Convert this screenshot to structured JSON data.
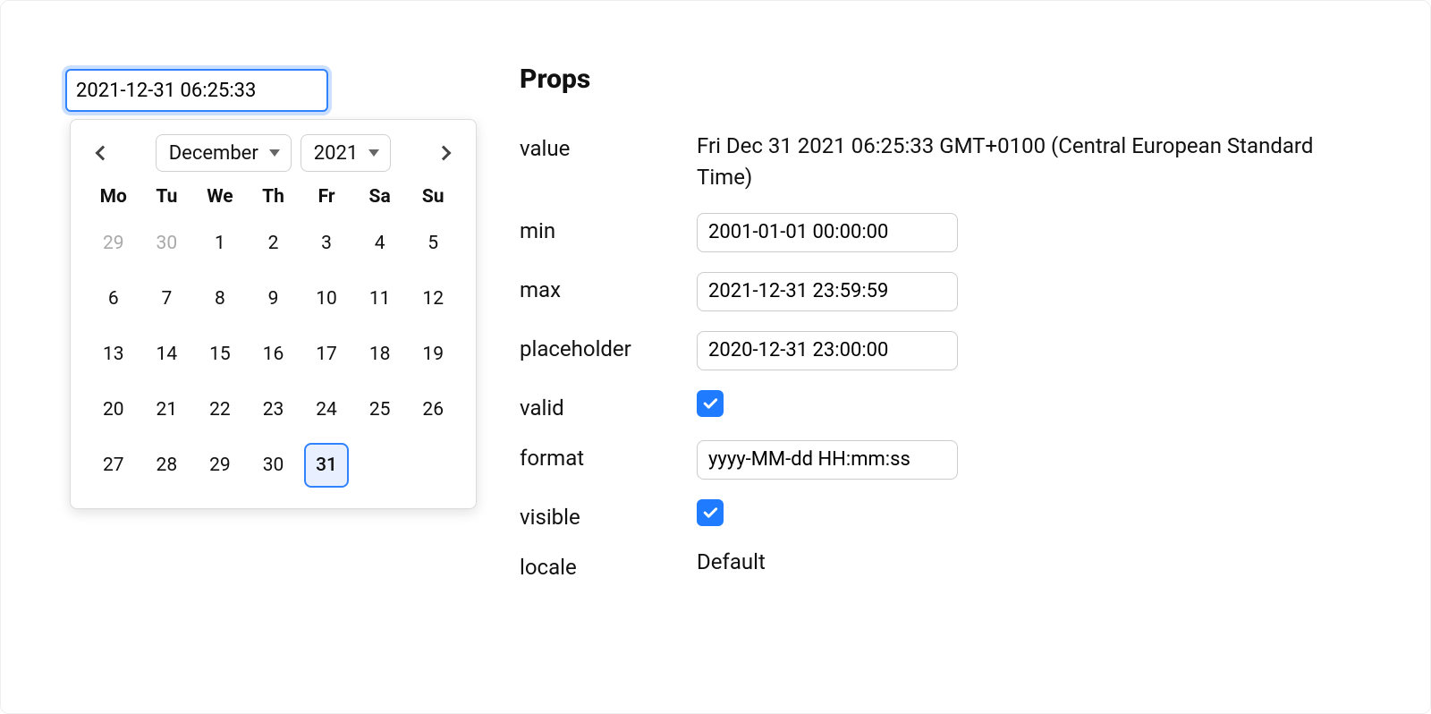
{
  "input": {
    "value": "2021-12-31 06:25:33"
  },
  "calendar": {
    "month_label": "December",
    "year_label": "2021",
    "weekdays": [
      "Mo",
      "Tu",
      "We",
      "Th",
      "Fr",
      "Sa",
      "Su"
    ],
    "days": [
      {
        "n": "29",
        "muted": true
      },
      {
        "n": "30",
        "muted": true
      },
      {
        "n": "1"
      },
      {
        "n": "2"
      },
      {
        "n": "3"
      },
      {
        "n": "4"
      },
      {
        "n": "5"
      },
      {
        "n": "6"
      },
      {
        "n": "7"
      },
      {
        "n": "8"
      },
      {
        "n": "9"
      },
      {
        "n": "10"
      },
      {
        "n": "11"
      },
      {
        "n": "12"
      },
      {
        "n": "13"
      },
      {
        "n": "14"
      },
      {
        "n": "15"
      },
      {
        "n": "16"
      },
      {
        "n": "17"
      },
      {
        "n": "18"
      },
      {
        "n": "19"
      },
      {
        "n": "20"
      },
      {
        "n": "21"
      },
      {
        "n": "22"
      },
      {
        "n": "23"
      },
      {
        "n": "24"
      },
      {
        "n": "25"
      },
      {
        "n": "26"
      },
      {
        "n": "27"
      },
      {
        "n": "28"
      },
      {
        "n": "29"
      },
      {
        "n": "30"
      },
      {
        "n": "31",
        "selected": true
      }
    ]
  },
  "props": {
    "heading": "Props",
    "labels": {
      "value": "value",
      "min": "min",
      "max": "max",
      "placeholder": "placeholder",
      "valid": "valid",
      "format": "format",
      "visible": "visible",
      "locale": "locale"
    },
    "value_text": "Fri Dec 31 2021 06:25:33 GMT+0100 (Central European Standard Time)",
    "min": "2001-01-01 00:00:00",
    "max": "2021-12-31 23:59:59",
    "placeholder": "2020-12-31 23:00:00",
    "valid": true,
    "format": "yyyy-MM-dd HH:mm:ss",
    "visible": true,
    "locale_text": "Default"
  }
}
